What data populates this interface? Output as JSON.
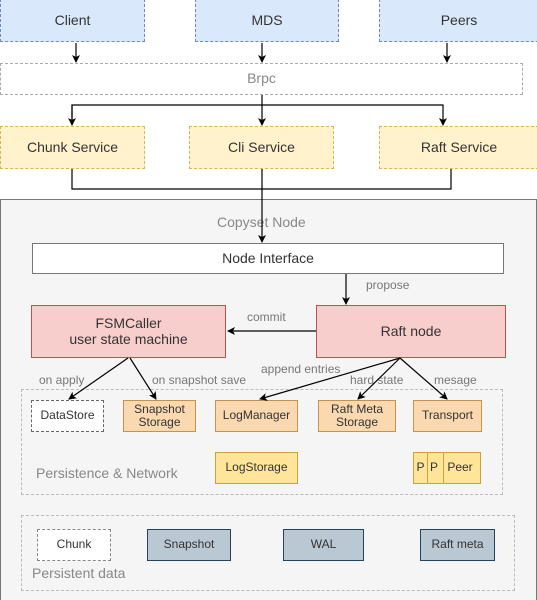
{
  "top": {
    "client": "Client",
    "mds": "MDS",
    "peers": "Peers",
    "brpc": "Brpc"
  },
  "services": {
    "chunk": "Chunk Service",
    "cli": "Cli Service",
    "raft": "Raft Service"
  },
  "copyset": {
    "title": "Copyset Node",
    "node_interface": "Node Interface",
    "propose": "propose",
    "fsmcaller_line1": "FSMCaller",
    "fsmcaller_line2": "user state machine",
    "raft_node": "Raft node",
    "commit": "commit",
    "on_apply": "on apply",
    "on_snapshot_save": "on snapshot save",
    "append_entries": "append entries",
    "hard_state": "hard state",
    "mesage": "mesage"
  },
  "persistence": {
    "title": "Persistence & Network",
    "datastore": "DataStore",
    "snapshot_storage_1": "Snapshot",
    "snapshot_storage_2": "Storage",
    "logmanager": "LogManager",
    "raftmeta_1": "Raft Meta",
    "raftmeta_2": "Storage",
    "transport": "Transport",
    "logstorage": "LogStorage",
    "peer_a": "P",
    "peer_b": "P",
    "peer_c": "Peer"
  },
  "persistent_data": {
    "title": "Persistent data",
    "chunk": "Chunk",
    "snapshot": "Snapshot",
    "wal": "WAL",
    "raft_meta": "Raft meta"
  },
  "colors": {
    "client_fill": "#dae8fc",
    "service_fill": "#fff2cc",
    "raft_fill": "#f8cecc",
    "storage_fill": "#fad9b0",
    "logstorage_fill": "#ffe599",
    "data_fill": "#bac8d3",
    "container_fill": "#f5f5f5"
  }
}
